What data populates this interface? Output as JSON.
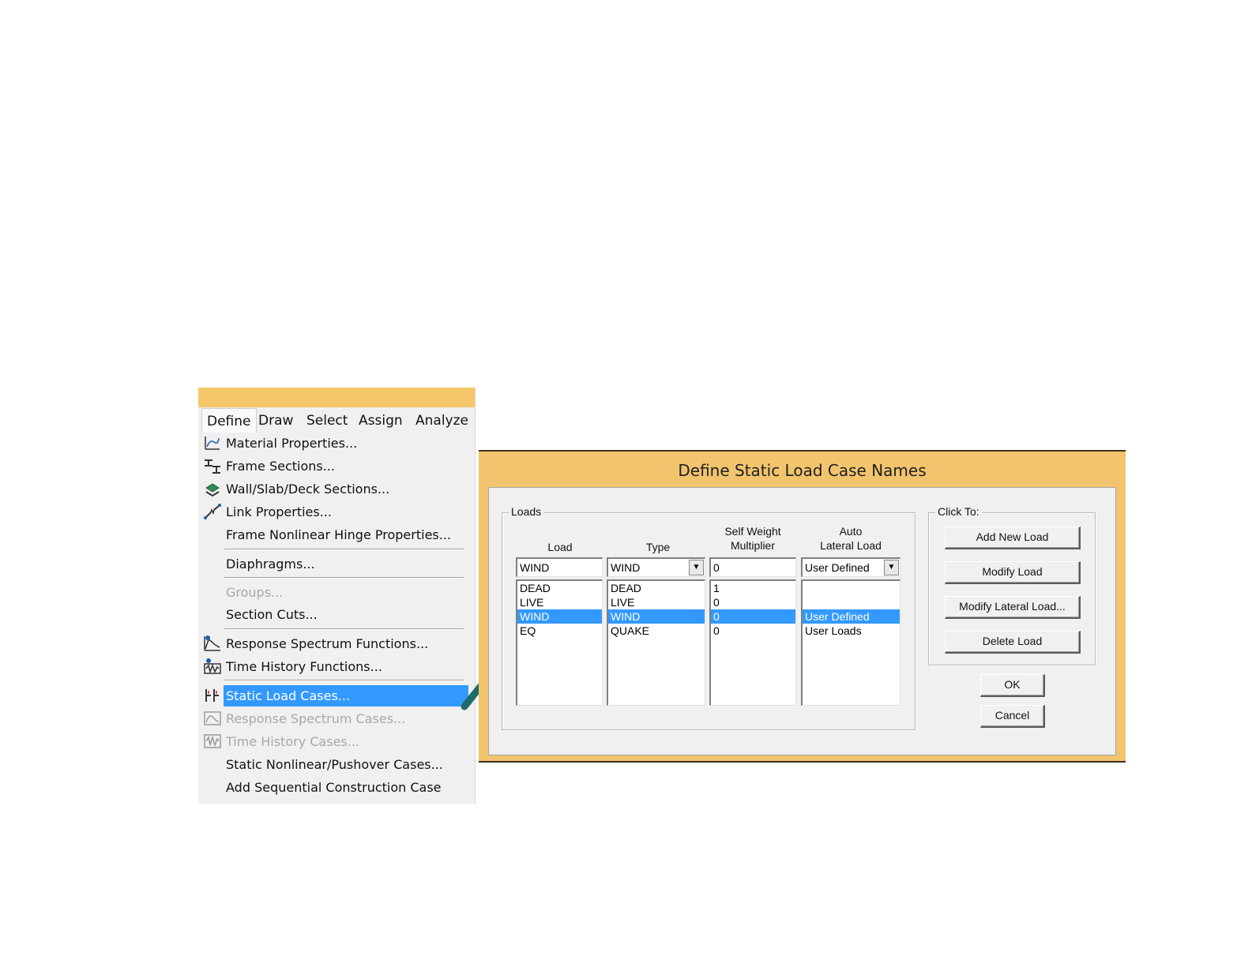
{
  "menubar": {
    "items": [
      "Define",
      "Draw",
      "Select",
      "Assign",
      "Analyze"
    ]
  },
  "menu": {
    "items": [
      {
        "label": "Material Properties...",
        "icon": "material-properties-icon"
      },
      {
        "label": "Frame Sections...",
        "icon": "frame-sections-icon"
      },
      {
        "label": "Wall/Slab/Deck Sections...",
        "icon": "wall-slab-deck-icon"
      },
      {
        "label": "Link Properties...",
        "icon": "link-properties-icon"
      },
      {
        "label": "Frame Nonlinear Hinge Properties..."
      },
      {
        "label": "Diaphragms..."
      },
      {
        "label": "Groups...",
        "disabled": true
      },
      {
        "label": "Section Cuts..."
      },
      {
        "label": "Response Spectrum Functions...",
        "icon": "response-spectrum-icon"
      },
      {
        "label": "Time History Functions...",
        "icon": "time-history-icon"
      },
      {
        "label": "Static Load Cases...",
        "icon": "static-load-icon",
        "highlighted": true
      },
      {
        "label": "Response Spectrum Cases...",
        "icon": "response-spectrum-cases-icon",
        "disabled": true
      },
      {
        "label": "Time History Cases...",
        "icon": "time-history-cases-icon",
        "disabled": true
      },
      {
        "label": "Static Nonlinear/Pushover Cases..."
      },
      {
        "label": "Add Sequential Construction Case"
      }
    ]
  },
  "dialog": {
    "title": "Define Static Load Case Names",
    "loads_group": "Loads",
    "click_group": "Click To:",
    "headers": {
      "load": "Load",
      "type": "Type",
      "self_weight_1": "Self Weight",
      "self_weight_2": "Multiplier",
      "auto_1": "Auto",
      "auto_2": "Lateral Load"
    },
    "inputs": {
      "load": "WIND",
      "type": "WIND",
      "multiplier": "0",
      "auto_lateral": "User Defined"
    },
    "rows": [
      {
        "load": "DEAD",
        "type": "DEAD",
        "multiplier": "1",
        "auto": ""
      },
      {
        "load": "LIVE",
        "type": "LIVE",
        "multiplier": "0",
        "auto": ""
      },
      {
        "load": "WIND",
        "type": "WIND",
        "multiplier": "0",
        "auto": "User Defined",
        "selected": true
      },
      {
        "load": "EQ",
        "type": "QUAKE",
        "multiplier": "0",
        "auto": "User Loads"
      }
    ],
    "buttons": {
      "add": "Add New Load",
      "modify": "Modify Load",
      "modify_lateral": "Modify Lateral Load...",
      "delete": "Delete Load",
      "ok": "OK",
      "cancel": "Cancel"
    }
  },
  "colors": {
    "accent_gold": "#f2c46d",
    "selection_blue": "#3399ff",
    "arrow_teal": "#1f6b6b"
  }
}
